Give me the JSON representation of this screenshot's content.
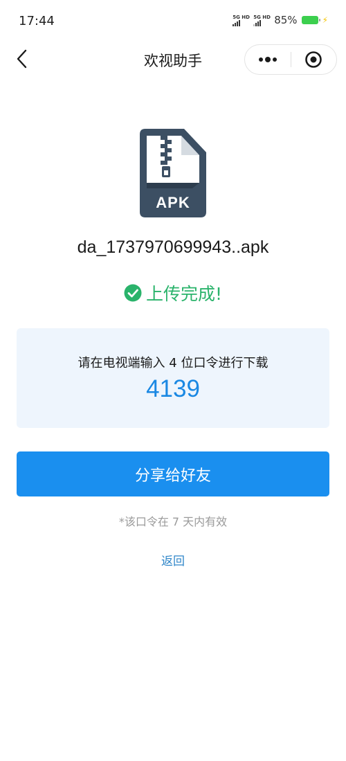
{
  "status_bar": {
    "time": "17:44",
    "signal_1_label": "5G HD",
    "signal_2_label": "5G HD",
    "battery_percent": "85%",
    "battery_level": 0.85,
    "charging": true
  },
  "nav": {
    "title": "欢视助手",
    "back_icon": "chevron-left-icon",
    "more_icon": "more-dots-icon",
    "close_icon": "target-close-icon"
  },
  "file": {
    "icon": "zip-file-icon",
    "type_label": "APK",
    "name": "da_1737970699943..apk"
  },
  "upload": {
    "icon": "check-circle-icon",
    "status_text": "上传完成!"
  },
  "code_card": {
    "instruction": "请在电视端输入 4 位口令进行下载",
    "code": "4139"
  },
  "actions": {
    "share_label": "分享给好友",
    "validity_note": "*该口令在 7 天内有效",
    "back_label": "返回"
  },
  "colors": {
    "primary_blue": "#1a8fef",
    "code_blue": "#1a88e3",
    "success_green": "#2ab36b",
    "card_bg": "#eef5fd",
    "icon_dark": "#3c4f63",
    "link_blue": "#2f86c9"
  }
}
